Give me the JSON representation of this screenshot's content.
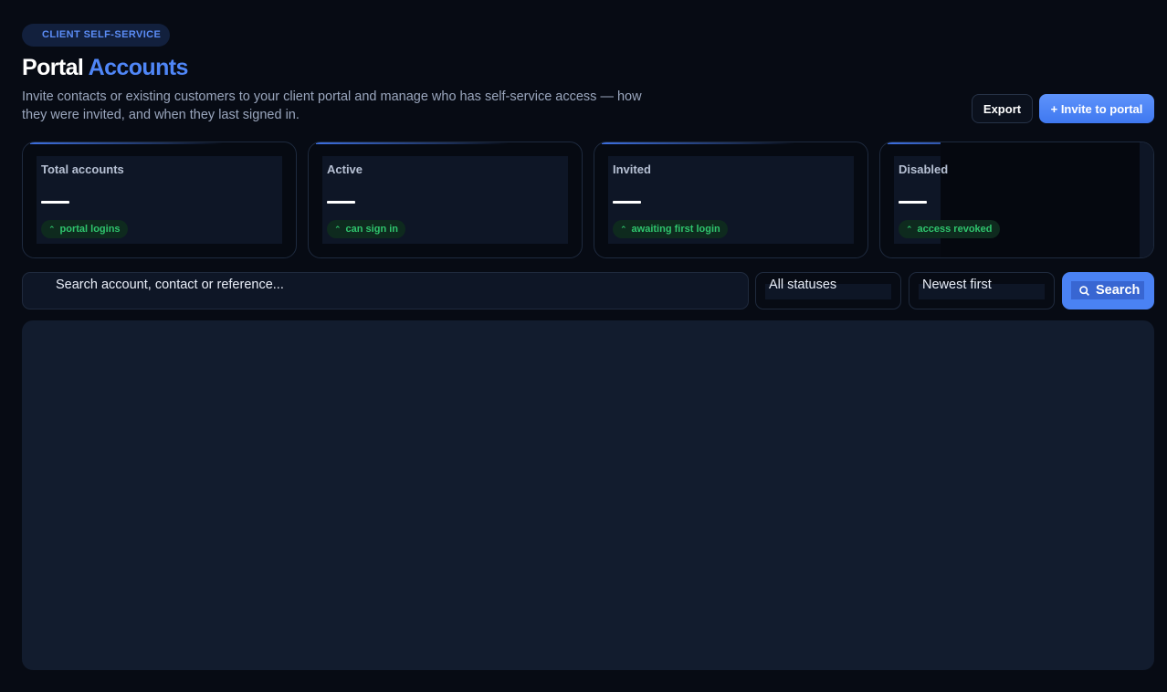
{
  "header": {
    "eyebrow": "CLIENT SELF-SERVICE",
    "title_main": "Portal",
    "title_accent": "Accounts",
    "subtitle": "Invite contacts or existing customers to your client portal and manage who has self-service access — how they were invited, and when they last signed in."
  },
  "actions": {
    "export_label": "Export",
    "invite_label": "+ Invite to portal"
  },
  "stats": [
    {
      "label": "Total accounts",
      "chip": "portal logins",
      "chip_icon": "chevron-up-icon"
    },
    {
      "label": "Active",
      "chip": "can sign in",
      "chip_icon": "chevron-up-icon"
    },
    {
      "label": "Invited",
      "chip": "awaiting first login",
      "chip_icon": "chevron-up-icon"
    },
    {
      "label": "Disabled",
      "chip": "access revoked",
      "chip_icon": "chevron-up-icon"
    }
  ],
  "filters": {
    "search_placeholder": "Search account, contact or reference...",
    "status_value": "All statuses",
    "sort_value": "Newest first",
    "search_button": "Search"
  },
  "colors": {
    "accent": "#4f86f7",
    "background": "#070b14",
    "success": "#2fc46d"
  }
}
